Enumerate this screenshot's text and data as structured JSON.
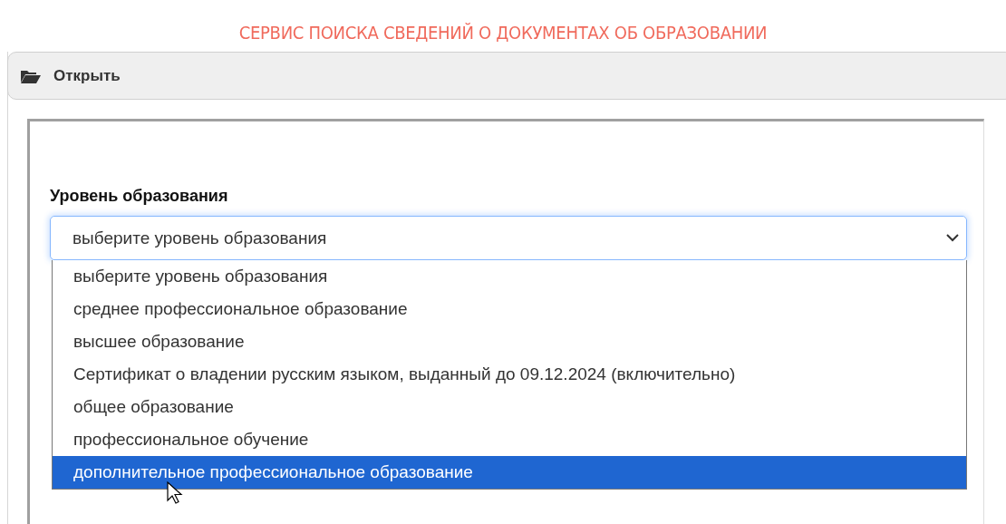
{
  "page_title": "СЕРВИС ПОИСКА СВЕДЕНИЙ О ДОКУМЕНТАХ ОБ ОБРАЗОВАНИИ",
  "panel": {
    "header": "Открыть",
    "expanded": true
  },
  "form": {
    "field_label": "Уровень образования",
    "select": {
      "value": "выберите уровень образования",
      "expanded": true,
      "options": [
        {
          "label": "выберите уровень образования",
          "highlighted": false
        },
        {
          "label": "среднее профессиональное образование",
          "highlighted": false
        },
        {
          "label": "высшее образование",
          "highlighted": false
        },
        {
          "label": "Сертификат о владении русским языком, выданный до 09.12.2024 (включительно)",
          "highlighted": false
        },
        {
          "label": "общее образование",
          "highlighted": false
        },
        {
          "label": "профессиональное обучение",
          "highlighted": false
        },
        {
          "label": "дополнительное профессиональное образование",
          "highlighted": true
        }
      ]
    }
  }
}
